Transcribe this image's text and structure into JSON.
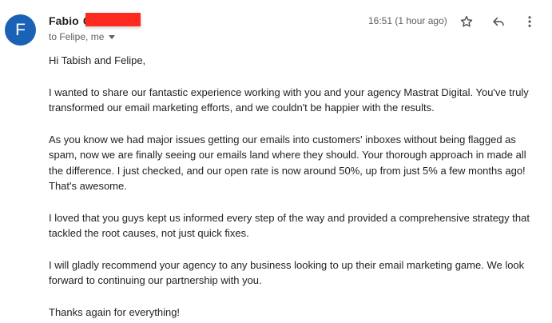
{
  "email": {
    "avatar_letter": "F",
    "avatar_color": "#1a62b5",
    "sender_name": "Fabio",
    "sender_name_partial": "C",
    "recipients": "to Felipe, me",
    "timestamp": "16:51 (1 hour ago)",
    "icons": {
      "star": "star-outline-icon",
      "reply": "reply-arrow-icon",
      "more": "more-vert-icon"
    },
    "body": [
      "Hi Tabish and Felipe,",
      "I wanted to share our fantastic experience working with you and your agency Mastrat Digital. You've truly transformed our email marketing efforts, and we couldn't be happier with the results.",
      "As you know we had major issues getting our emails into customers' inboxes without being flagged as spam, now we are finally seeing our emails land where they should. Your thorough approach in made all the difference. I just checked, and our open rate is now around 50%, up from just 5% a few months ago! That's awesome.",
      "I loved that you guys kept us informed every step of the way and provided a comprehensive strategy that tackled the root causes, not just quick fixes.",
      "I will gladly recommend your agency to any business looking to up their email marketing game. We look forward to continuing our partnership with you.",
      "Thanks again for everything!"
    ]
  },
  "colors": {
    "redaction": "#ff2a1f",
    "secondary_text": "#5e5e5e",
    "icon": "#444746"
  }
}
